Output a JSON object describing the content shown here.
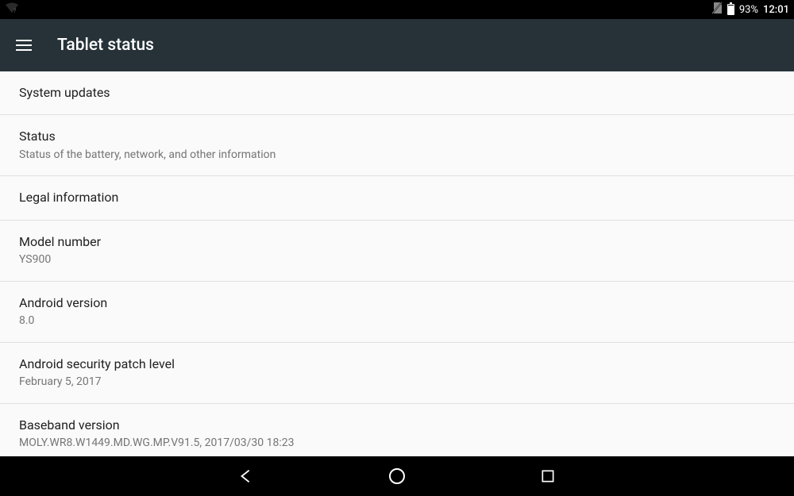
{
  "statusbar": {
    "battery_pct": "93%",
    "clock": "12:01"
  },
  "appbar": {
    "title": "Tablet status"
  },
  "rows": [
    {
      "title": "System updates",
      "sub": null
    },
    {
      "title": "Status",
      "sub": "Status of the battery, network, and other information"
    },
    {
      "title": "Legal information",
      "sub": null
    },
    {
      "title": "Model number",
      "sub": "YS900"
    },
    {
      "title": "Android version",
      "sub": "8.0"
    },
    {
      "title": "Android security patch level",
      "sub": "February 5, 2017"
    },
    {
      "title": "Baseband version",
      "sub": "MOLY.WR8.W1449.MD.WG.MP.V91.5, 2017/03/30 18:23"
    }
  ]
}
